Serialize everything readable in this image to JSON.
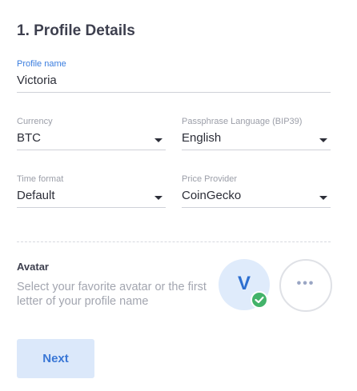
{
  "section_title": "1. Profile Details",
  "profile_name": {
    "label": "Profile name",
    "value": "Victoria"
  },
  "currency": {
    "label": "Currency",
    "value": "BTC"
  },
  "passphrase_language": {
    "label": "Passphrase Language (BIP39)",
    "value": "English"
  },
  "time_format": {
    "label": "Time format",
    "value": "Default"
  },
  "price_provider": {
    "label": "Price Provider",
    "value": "CoinGecko"
  },
  "avatar": {
    "title": "Avatar",
    "description": "Select your favorite avatar or the first letter of your profile name",
    "letter": "V",
    "more_label": "•••"
  },
  "next_button": "Next",
  "colors": {
    "accent": "#3a7ddf",
    "avatar_bg": "#dfebfb",
    "check_green": "#43b36a",
    "button_bg": "#dbe8fa"
  }
}
